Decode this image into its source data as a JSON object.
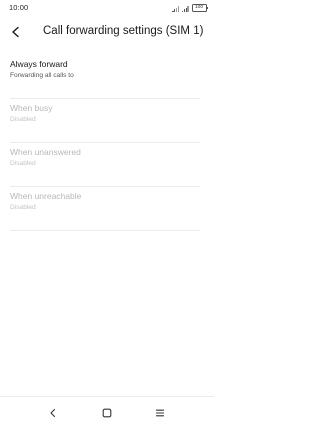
{
  "status_bar": {
    "time": "10:00",
    "battery": "100",
    "icons": [
      "signal-icon",
      "signal-icon",
      "battery-icon"
    ]
  },
  "header": {
    "back_icon": "back-arrow-icon",
    "title": "Call forwarding settings (SIM 1)"
  },
  "settings": {
    "items": [
      {
        "title": "Always forward",
        "subtitle": "Forwarding all calls to",
        "enabled": true
      },
      {
        "title": "When busy",
        "subtitle": "Disabled",
        "enabled": false
      },
      {
        "title": "When unanswered",
        "subtitle": "Disabled",
        "enabled": false
      },
      {
        "title": "When unreachable",
        "subtitle": "Disabled",
        "enabled": false
      }
    ]
  },
  "nav_bar": {
    "icons": [
      "nav-back-icon",
      "nav-home-icon",
      "nav-menu-icon"
    ]
  },
  "colors": {
    "background": "#ffffff",
    "text_primary": "#1a1a1a",
    "text_disabled": "#b8b8b8",
    "divider": "#ececec"
  }
}
